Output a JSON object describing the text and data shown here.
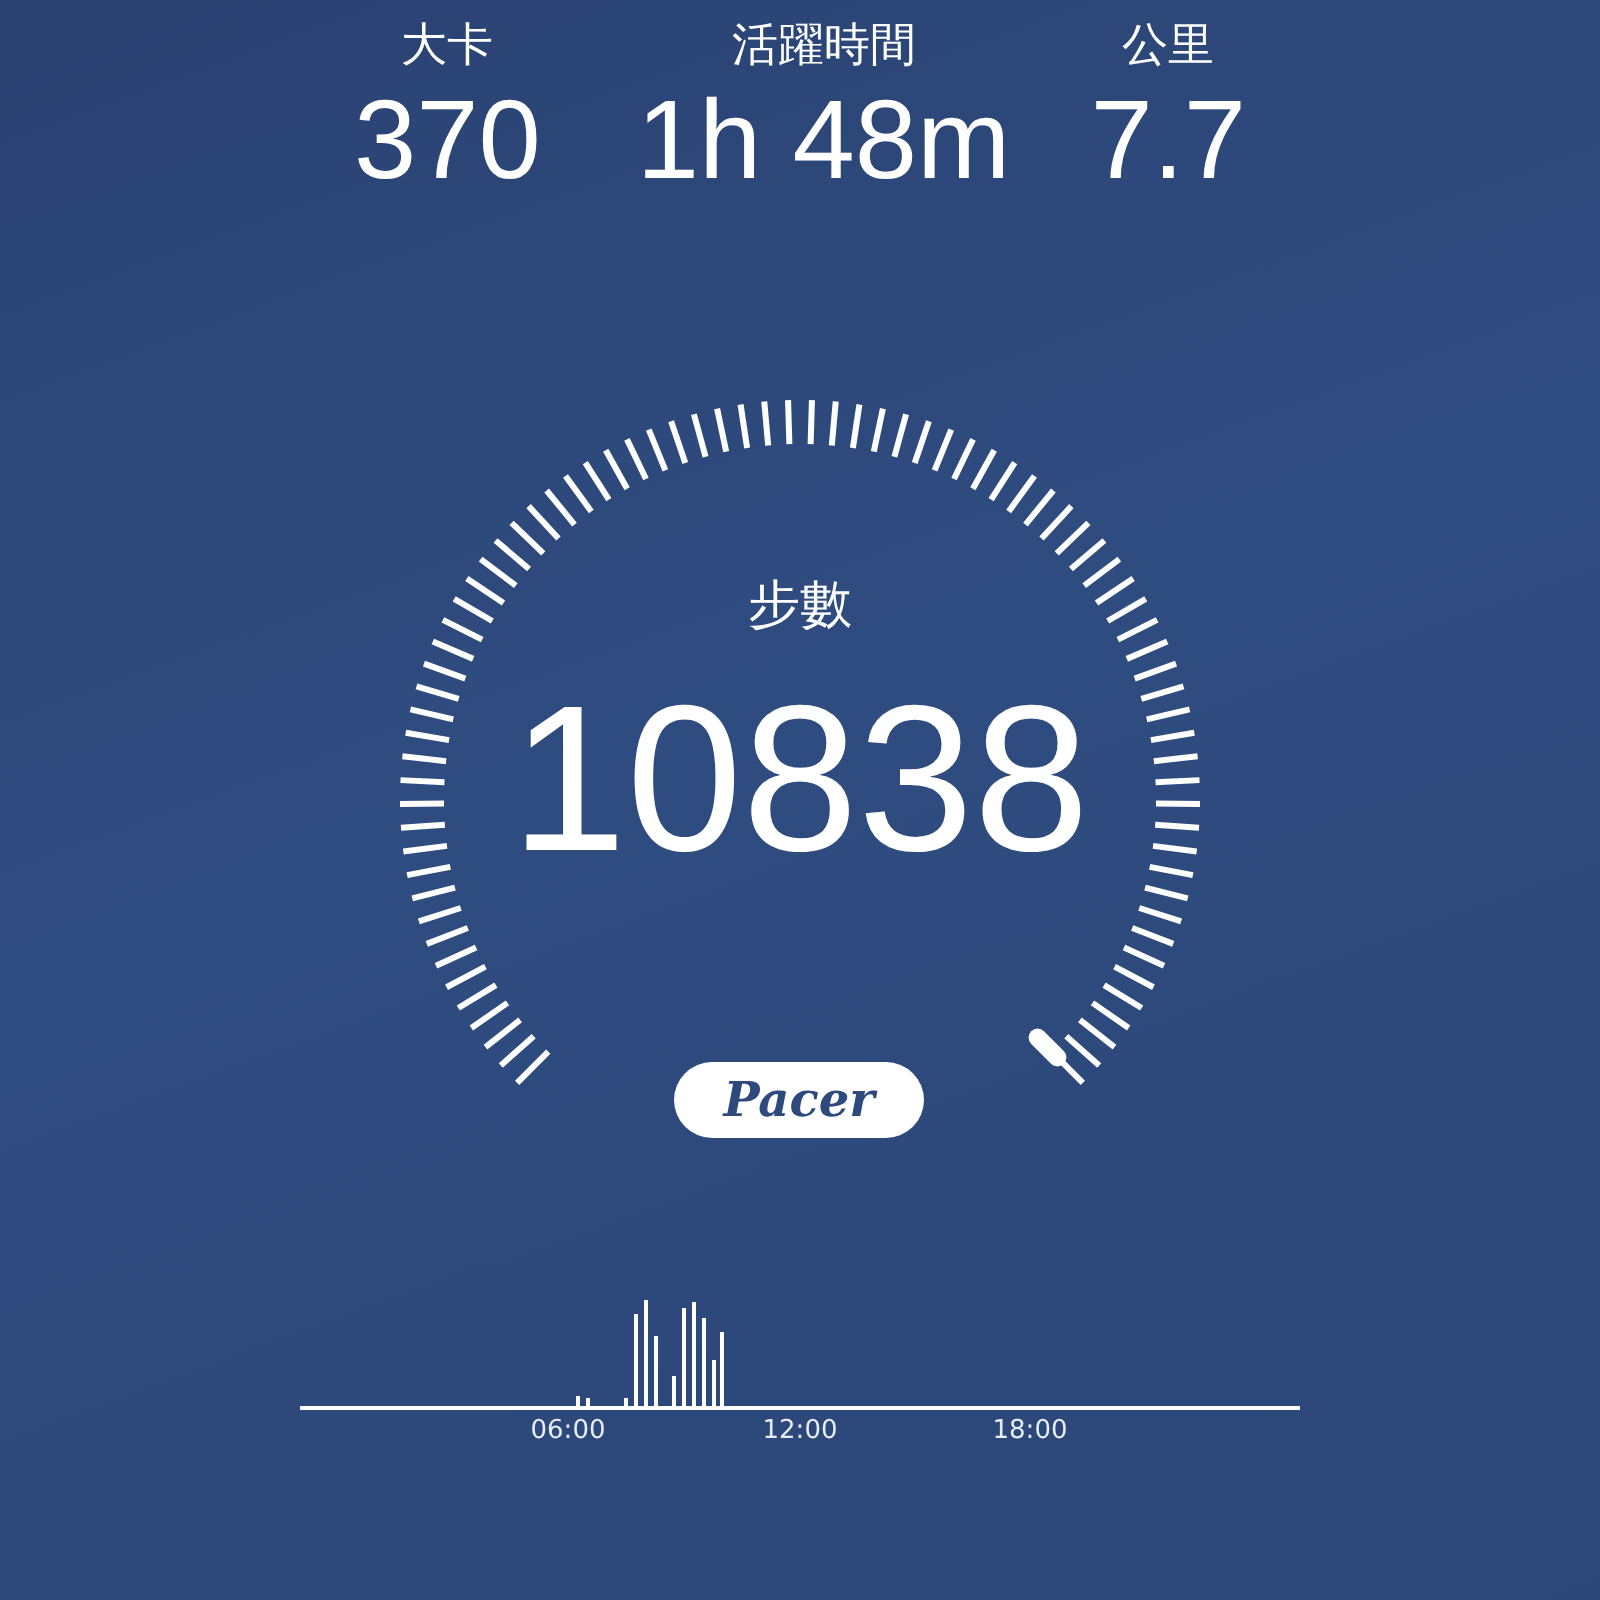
{
  "stats": [
    {
      "label": "大卡",
      "value": "370"
    },
    {
      "label": "活躍時間",
      "value": "1h 48m"
    },
    {
      "label": "公里",
      "value": "7.7"
    }
  ],
  "gauge": {
    "label": "步數",
    "value": "10838"
  },
  "logo": {
    "text": "Pacer"
  },
  "chart": {
    "x_labels": [
      "06:00",
      "12:00",
      "18:00"
    ]
  }
}
